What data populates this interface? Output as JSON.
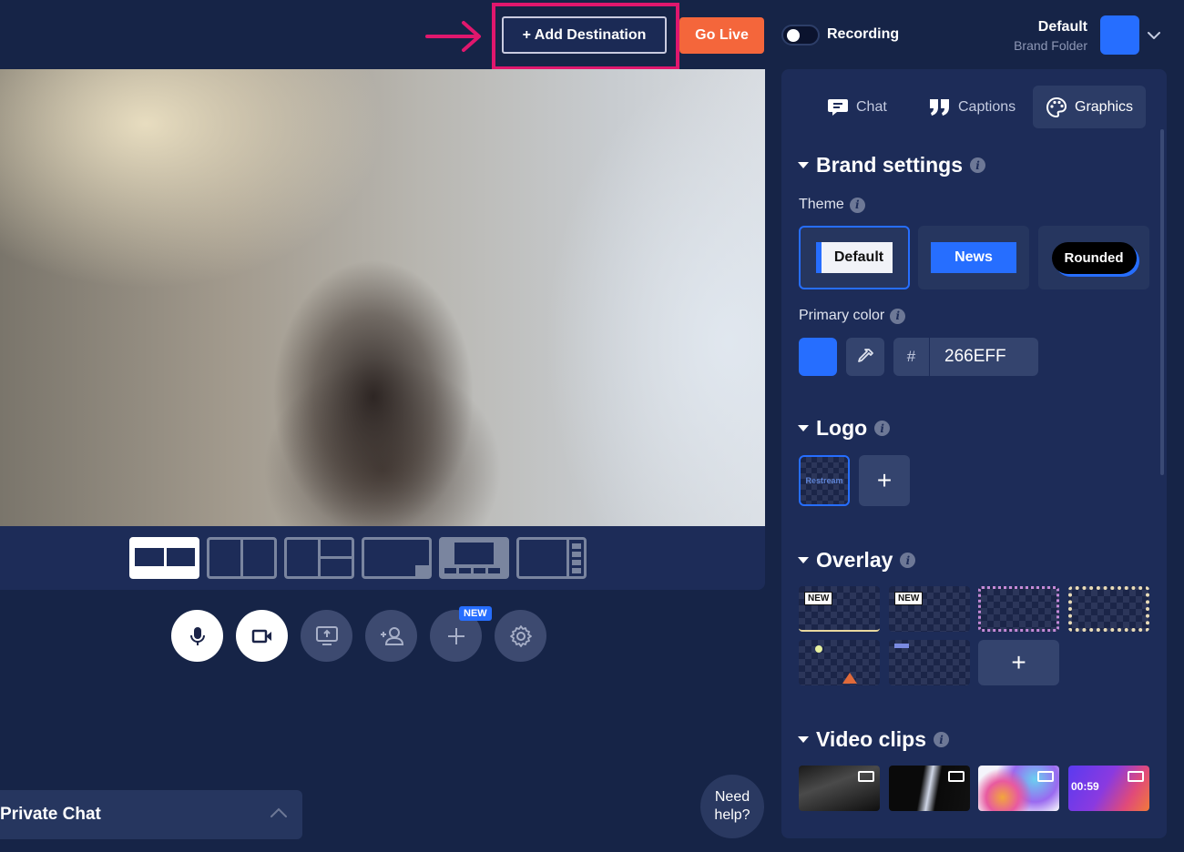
{
  "topbar": {
    "add_destination_label": "+ Add Destination",
    "go_live_label": "Go Live",
    "recording_label": "Recording",
    "brand_name": "Default",
    "brand_folder": "Brand Folder"
  },
  "controls": {
    "new_badge": "NEW"
  },
  "private_chat_label": "Private Chat",
  "need_help": {
    "line1": "Need",
    "line2": "help?"
  },
  "panel": {
    "tabs": [
      {
        "label": "Chat",
        "icon": "chat-icon"
      },
      {
        "label": "Captions",
        "icon": "quote-icon"
      },
      {
        "label": "Graphics",
        "icon": "palette-icon",
        "active": true
      }
    ],
    "brand_settings": {
      "title": "Brand settings",
      "theme_label": "Theme",
      "themes": [
        {
          "label": "Default",
          "selected": true
        },
        {
          "label": "News"
        },
        {
          "label": "Rounded"
        }
      ],
      "primary_color_label": "Primary color",
      "hash": "#",
      "hex_value": "266EFF"
    },
    "logo": {
      "title": "Logo",
      "thumb_text": "Restream",
      "add_symbol": "+"
    },
    "overlay": {
      "title": "Overlay",
      "new_badge": "NEW",
      "add_symbol": "+"
    },
    "video_clips": {
      "title": "Video clips",
      "durations": [
        "00:59"
      ]
    }
  },
  "colors": {
    "background": "#162447",
    "primary": "#266EFF",
    "go_live": "#f4663b",
    "highlight": "#e0176d"
  }
}
